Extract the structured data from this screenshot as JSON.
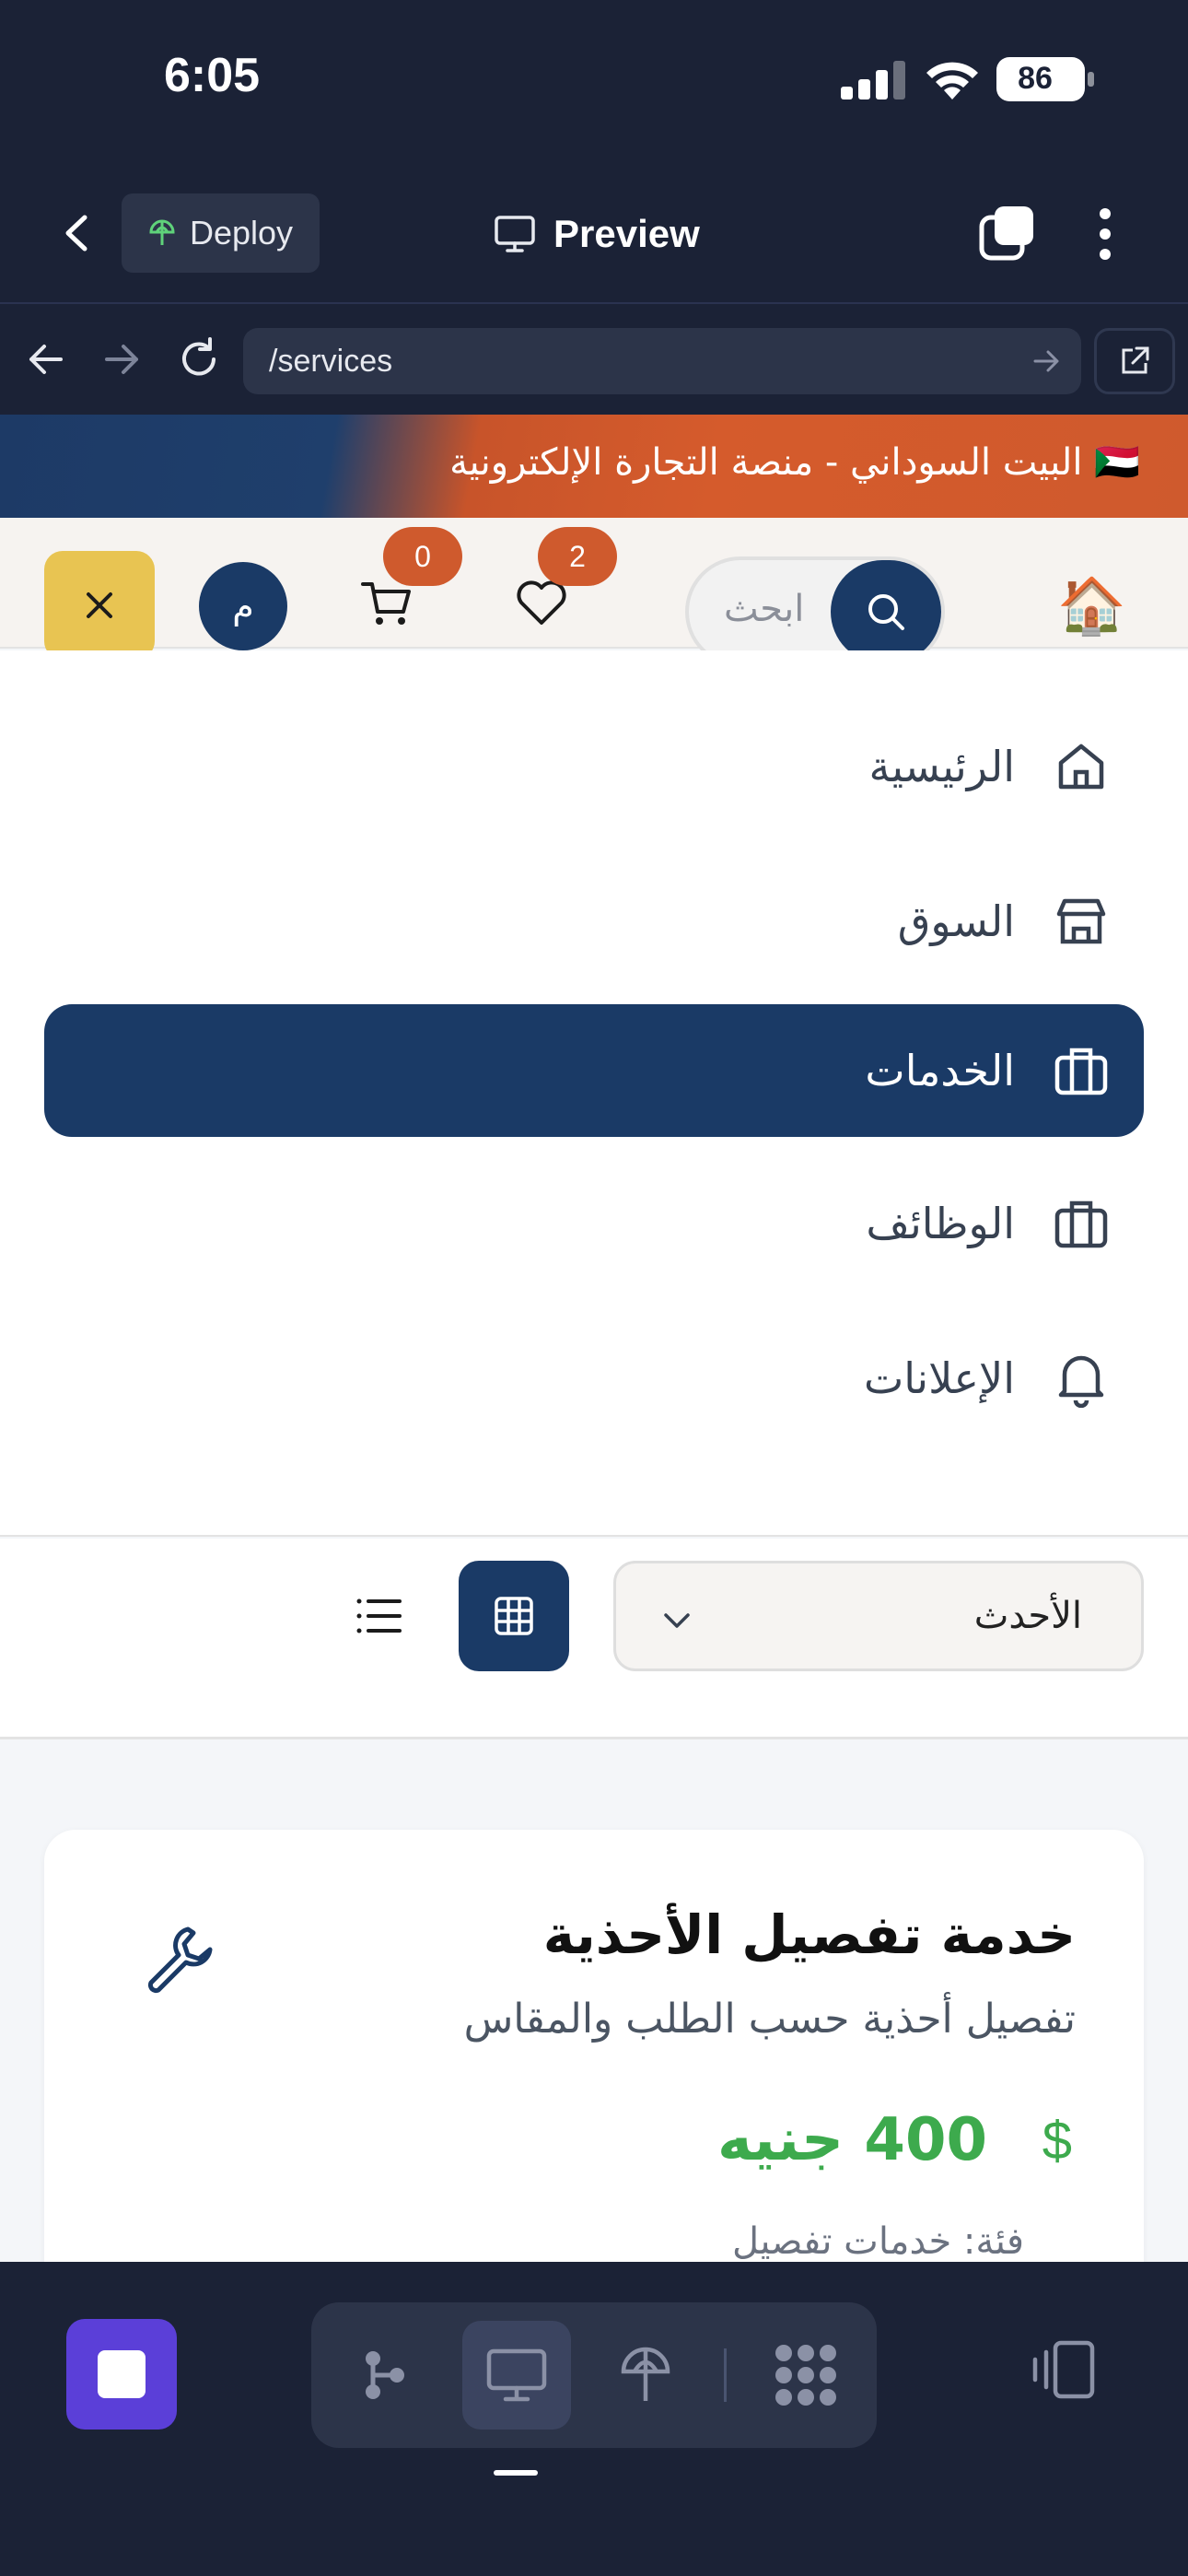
{
  "status_bar": {
    "time": "6:05",
    "battery": "86"
  },
  "app_bar": {
    "deploy_label": "Deploy",
    "preview_label": "Preview"
  },
  "url_bar": {
    "url": "/services"
  },
  "site": {
    "banner": "🇸🇩 البيت السوداني - منصة التجارة الإلكترونية",
    "search_placeholder": "ابحث",
    "avatar_letter": "م",
    "cart_count": "0",
    "wishlist_count": "2",
    "home_emoji": "🏠"
  },
  "menu": {
    "items": [
      {
        "label": "الرئيسية",
        "icon": "home-icon",
        "active": false
      },
      {
        "label": "السوق",
        "icon": "store-icon",
        "active": false
      },
      {
        "label": "الخدمات",
        "icon": "briefcase-icon",
        "active": true
      },
      {
        "label": "الوظائف",
        "icon": "briefcase-icon",
        "active": false
      },
      {
        "label": "الإعلانات",
        "icon": "bell-icon",
        "active": false
      }
    ]
  },
  "toolbar": {
    "sort_value": "الأحدث"
  },
  "card": {
    "title": "خدمة تفصيل الأحذية",
    "description": "تفصيل أحذية حسب الطلب والمقاس",
    "price": "400 جنيه",
    "currency_symbol": "$",
    "category": "فئة: خدمات تفصيل"
  },
  "colors": {
    "primary": "#1a3a66",
    "accent_orange": "#cf5a2d",
    "yellow": "#e8c452",
    "price_green": "#3daa4d",
    "app_dark": "#1b2236",
    "stop_purple": "#5b3fd8"
  }
}
